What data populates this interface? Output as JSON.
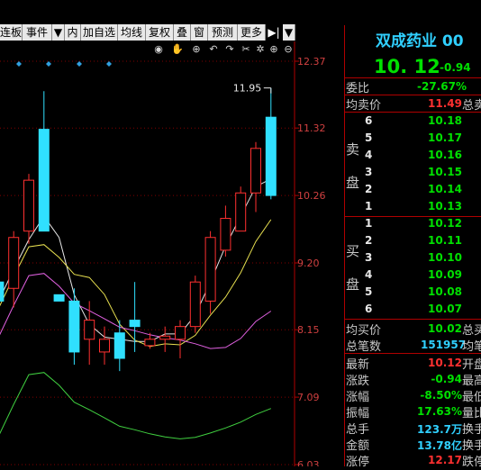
{
  "tabs": [
    {
      "label": "连板"
    },
    {
      "label": "事件"
    },
    {
      "label": "▼"
    },
    {
      "label": "内"
    },
    {
      "label": "加自选"
    },
    {
      "label": "均线"
    },
    {
      "label": "复权"
    },
    {
      "label": "叠"
    },
    {
      "label": "窗"
    },
    {
      "label": "预测"
    },
    {
      "label": "更多"
    },
    {
      "label": "▶|"
    },
    {
      "label": "▼"
    }
  ],
  "chart_data": {
    "type": "candlestick",
    "y_ticks": [
      "12.37",
      "11.32",
      "10.26",
      "9.20",
      "8.15",
      "7.09",
      "6.03"
    ],
    "ylim": [
      6.03,
      12.37
    ],
    "high_label": "11.95",
    "candles": [
      {
        "open": 8.9,
        "close": 8.6,
        "high": 9.0,
        "low": 8.3
      },
      {
        "open": 8.8,
        "close": 9.6,
        "high": 9.7,
        "low": 8.5
      },
      {
        "open": 9.7,
        "close": 10.5,
        "high": 10.6,
        "low": 9.5
      },
      {
        "open": 11.3,
        "close": 9.7,
        "high": 11.9,
        "low": 9.7
      },
      {
        "open": 8.7,
        "close": 8.6,
        "high": 8.7,
        "low": 8.6
      },
      {
        "open": 8.6,
        "close": 7.8,
        "high": 8.8,
        "low": 7.6
      },
      {
        "open": 8.0,
        "close": 8.3,
        "high": 8.6,
        "low": 7.6
      },
      {
        "open": 7.8,
        "close": 8.0,
        "high": 8.2,
        "low": 7.6
      },
      {
        "open": 8.1,
        "close": 7.7,
        "high": 8.3,
        "low": 7.5
      },
      {
        "open": 8.3,
        "close": 8.2,
        "high": 8.9,
        "low": 7.8
      },
      {
        "open": 7.9,
        "close": 8.0,
        "high": 8.1,
        "low": 7.85
      },
      {
        "open": 8.0,
        "close": 8.05,
        "high": 8.2,
        "low": 7.8
      },
      {
        "open": 8.0,
        "close": 8.2,
        "high": 8.3,
        "low": 7.7
      },
      {
        "open": 8.2,
        "close": 8.9,
        "high": 9.0,
        "low": 8.1
      },
      {
        "open": 8.6,
        "close": 9.6,
        "high": 9.7,
        "low": 8.4
      },
      {
        "open": 9.4,
        "close": 9.9,
        "high": 10.1,
        "low": 9.3
      },
      {
        "open": 9.7,
        "close": 10.3,
        "high": 10.4,
        "low": 9.7
      },
      {
        "open": 10.3,
        "close": 11.0,
        "high": 11.1,
        "low": 10.0
      },
      {
        "open": 11.49,
        "close": 10.26,
        "high": 11.95,
        "low": 10.2
      }
    ]
  },
  "stock": {
    "name": "双成药业 00",
    "price": "10. 12",
    "change": "-0.94"
  },
  "quote": {
    "weibi_label": "委比",
    "weibi_value": "-27.67%",
    "junmai_label": "均卖价",
    "junmai_value": "11.49",
    "junmai_extra": "总卖",
    "sell_label_1": "卖",
    "sell_label_2": "盘",
    "buy_label_1": "买",
    "buy_label_2": "盘",
    "sells": [
      {
        "level": "6",
        "price": "10.18"
      },
      {
        "level": "5",
        "price": "10.17"
      },
      {
        "level": "4",
        "price": "10.16"
      },
      {
        "level": "3",
        "price": "10.15"
      },
      {
        "level": "2",
        "price": "10.14"
      },
      {
        "level": "1",
        "price": "10.13"
      }
    ],
    "buys": [
      {
        "level": "1",
        "price": "10.12"
      },
      {
        "level": "2",
        "price": "10.11"
      },
      {
        "level": "3",
        "price": "10.10"
      },
      {
        "level": "4",
        "price": "10.09"
      },
      {
        "level": "5",
        "price": "10.08"
      },
      {
        "level": "6",
        "price": "10.07"
      }
    ],
    "junmai2_label": "均买价",
    "junmai2_value": "10.02",
    "junmai2_extra": "总买",
    "zongbi_label": "总笔数",
    "zongbi_value": "151957",
    "zongbi_extra": "均笔",
    "stats": [
      {
        "label": "最新",
        "value": "10.12",
        "extra": "开盘",
        "color": "#ff3030"
      },
      {
        "label": "涨跌",
        "value": "-0.94",
        "extra": "最高",
        "color": "#00e000"
      },
      {
        "label": "涨幅",
        "value": "-8.50%",
        "extra": "最低",
        "color": "#00e000"
      },
      {
        "label": "振幅",
        "value": "17.63%",
        "extra": "量比",
        "color": "#00e000"
      },
      {
        "label": "总手",
        "value": "123.7万",
        "extra": "换手",
        "color": "#30d0ff"
      },
      {
        "label": "金额",
        "value": "13.78亿",
        "extra": "换手",
        "color": "#30d0ff"
      },
      {
        "label": "涨停",
        "value": "12.17",
        "extra": "跌停",
        "color": "#ff3030"
      }
    ]
  }
}
